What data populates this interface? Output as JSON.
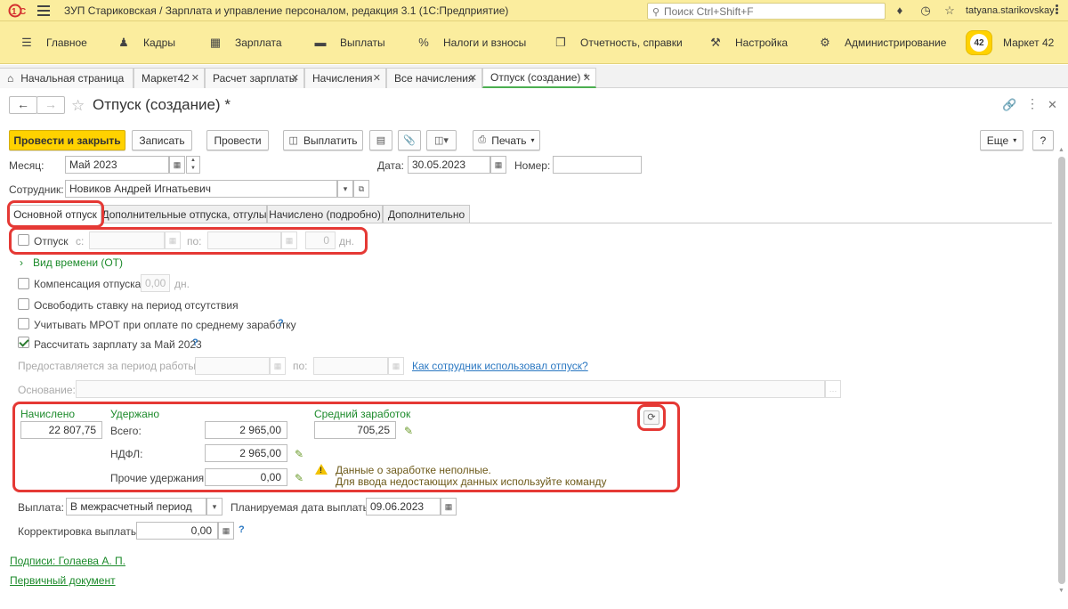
{
  "app": {
    "title": "ЗУП Стариковская / Зарплата и управление персоналом, редакция 3.1 (1С:Предприятие)",
    "search_placeholder": "Поиск Ctrl+Shift+F",
    "user": "tatyana.starikovskay",
    "logo": "1С"
  },
  "sections": [
    {
      "label": "Главное",
      "icon": "menu-icon"
    },
    {
      "label": "Кадры",
      "icon": "people-icon"
    },
    {
      "label": "Зарплата",
      "icon": "calculator-icon"
    },
    {
      "label": "Выплаты",
      "icon": "wallet-icon"
    },
    {
      "label": "Налоги и взносы",
      "icon": "percent-icon"
    },
    {
      "label": "Отчетность, справки",
      "icon": "reports-icon"
    },
    {
      "label": "Настройка",
      "icon": "wrench-icon"
    },
    {
      "label": "Администрирование",
      "icon": "gear-icon"
    },
    {
      "label": "Маркет 42",
      "icon": "market42-icon",
      "badge": "42"
    }
  ],
  "open_tabs": [
    {
      "label": "Начальная страница"
    },
    {
      "label": "Маркет42"
    },
    {
      "label": "Расчет зарплаты"
    },
    {
      "label": "Начисления"
    },
    {
      "label": "Все начисления"
    },
    {
      "label": "Отпуск (создание) *"
    }
  ],
  "form": {
    "title": "Отпуск (создание) *",
    "toolbar": {
      "post_close": "Провести и закрыть",
      "save": "Записать",
      "post": "Провести",
      "pay": "Выплатить",
      "print": "Печать",
      "more": "Еще",
      "help": "?"
    },
    "month_label": "Месяц:",
    "month_value": "Май 2023",
    "date_label": "Дата:",
    "date_value": "30.05.2023",
    "number_label": "Номер:",
    "number_value": "",
    "employee_label": "Сотрудник:",
    "employee_value": "Новиков Андрей Игнатьевич"
  },
  "form_tabs": [
    {
      "label": "Основной отпуск"
    },
    {
      "label": "Дополнительные отпуска, отгулы"
    },
    {
      "label": "Начислено (подробно)"
    },
    {
      "label": "Дополнительно"
    }
  ],
  "main_tab": {
    "vacation_label": "Отпуск",
    "from_label": "с:",
    "to_label": "по:",
    "days_value": "0",
    "days_unit": "дн.",
    "time_type_link": "Вид времени (ОТ)",
    "compensation_label": "Компенсация отпуска",
    "compensation_value": "0,00",
    "compensation_unit": "дн.",
    "free_rate_label": "Освободить ставку на период отсутствия",
    "mrot_label": "Учитывать МРОТ при оплате по среднему заработку",
    "calc_salary_label": "Рассчитать зарплату за Май 2023",
    "period_label": "Предоставляется за период работы с:",
    "period_to_label": "по:",
    "usage_link": "Как сотрудник использовал отпуск?",
    "basis_label": "Основание:",
    "basis_value": ""
  },
  "totals": {
    "accrued_label": "Начислено",
    "accrued_value": "22 807,75",
    "withheld_label": "Удержано",
    "total_label": "Всего:",
    "total_value": "2 965,00",
    "ndfl_label": "НДФЛ:",
    "ndfl_value": "2 965,00",
    "other_label": "Прочие удержания:",
    "other_value": "0,00",
    "avg_label": "Средний заработок",
    "avg_value": "705,25",
    "warning_line1": "Данные о заработке неполные.",
    "warning_line2": "Для ввода недостающих данных используйте команду"
  },
  "payment": {
    "payout_label": "Выплата:",
    "payout_value": "В межрасчетный период",
    "plan_date_label": "Планируемая дата выплаты:",
    "plan_date_value": "09.06.2023",
    "adjust_label": "Корректировка выплаты:",
    "adjust_value": "0,00"
  },
  "footer": {
    "signatures_link": "Подписи: Голаева А. П.",
    "primary_doc_link": "Первичный документ"
  },
  "colors": {
    "header_bg": "#fbed9e",
    "primary_button": "#ffd200",
    "highlight": "#e53935",
    "link_green": "#1b8a2a",
    "link_blue": "#2b78c2"
  }
}
